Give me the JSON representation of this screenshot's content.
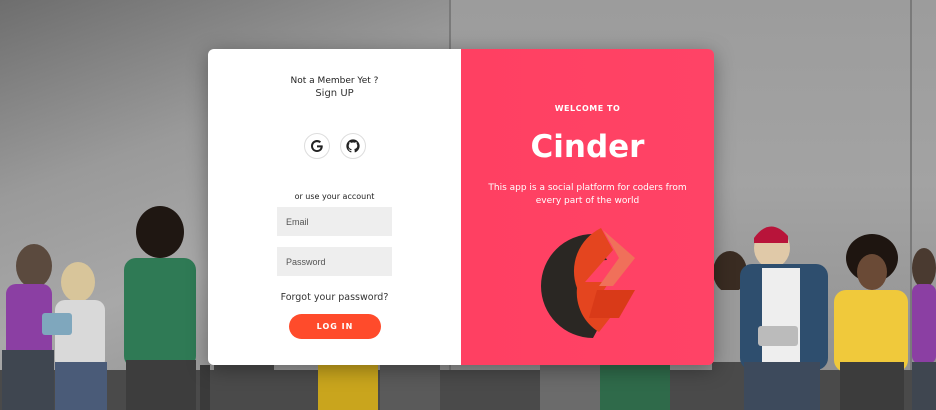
{
  "login_panel": {
    "not_member_text": "Not a Member Yet ?",
    "signup_label": "Sign UP",
    "social_icons": [
      "google-icon",
      "github-icon"
    ],
    "or_text": "or use your account",
    "email_placeholder": "Email",
    "password_placeholder": "Password",
    "forgot_label": "Forgot your password?",
    "login_label": "LOG IN"
  },
  "welcome_panel": {
    "welcome_text": "WELCOME TO",
    "brand_name": "Cinder",
    "tagline": "This app is a social platform for coders from every part of the world"
  },
  "colors": {
    "accent": "#ff4b2b",
    "panel": "#ff416c",
    "field_bg": "#eeeeee"
  }
}
